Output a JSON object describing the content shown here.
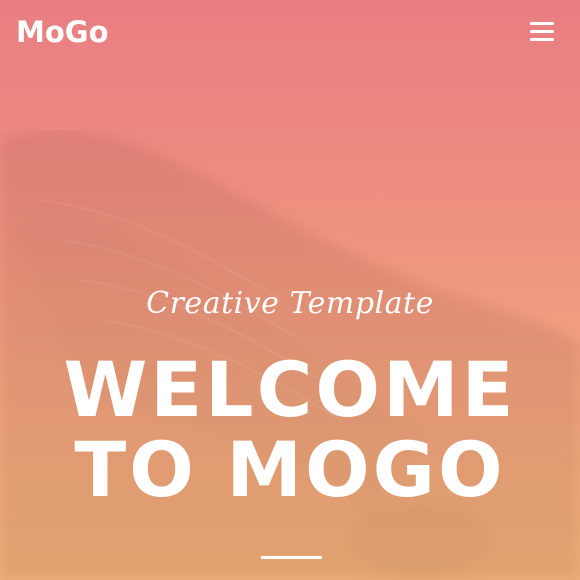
{
  "header": {
    "logo": "MoGo",
    "menu_icon": "hamburger-menu-icon"
  },
  "hero": {
    "subtitle": "Creative Template",
    "title_line1": "WELCOME",
    "title_line2": "TO MOGO",
    "background_image": "eagle-photo",
    "gradient_top": "#e97d82",
    "gradient_bottom": "#f0b27a"
  }
}
